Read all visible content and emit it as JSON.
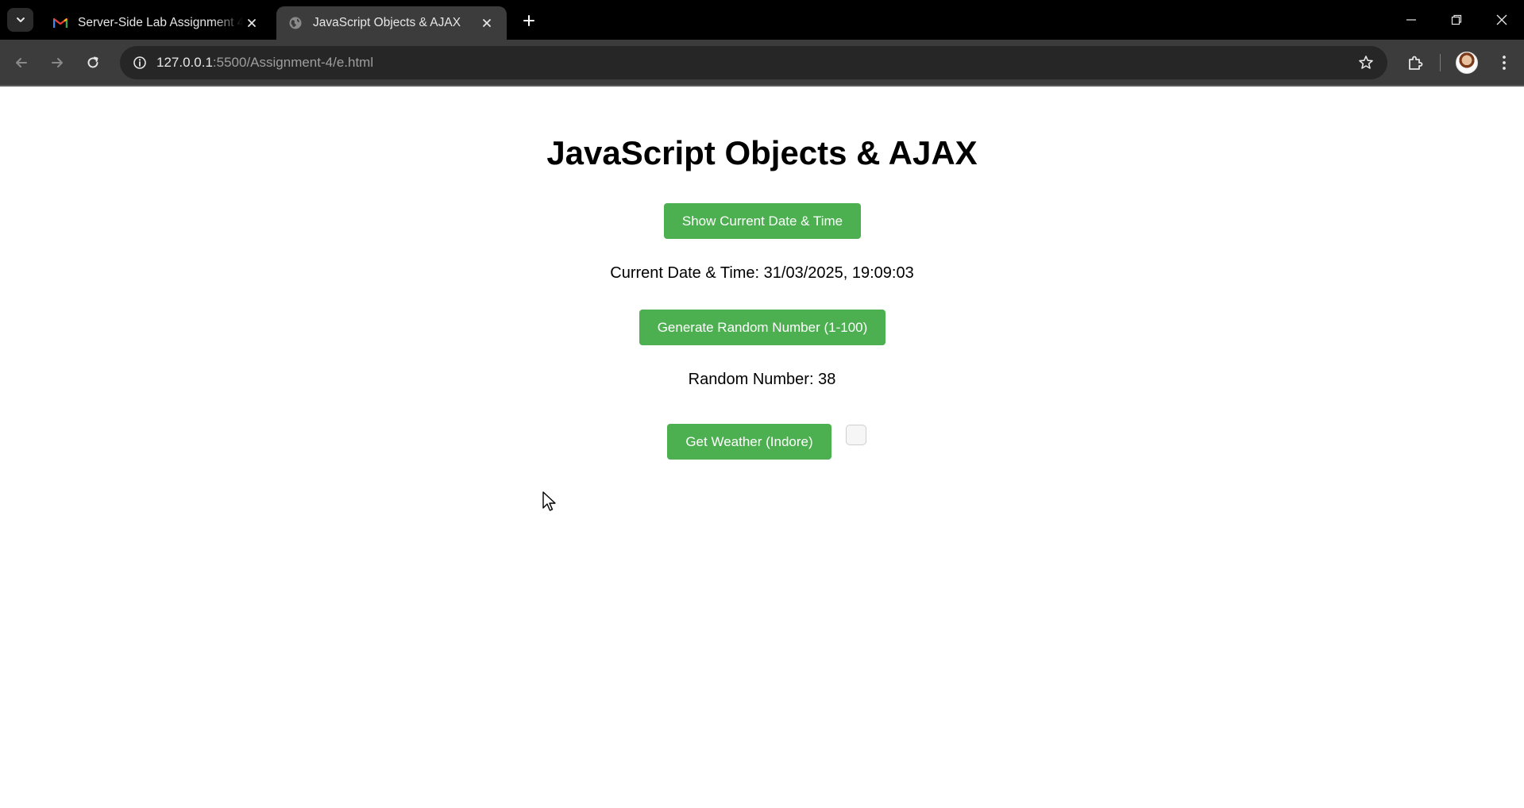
{
  "browser": {
    "tabs": [
      {
        "title": "Server-Side Lab Assignment 4 -",
        "favicon": "gmail-icon",
        "active": false
      },
      {
        "title": "JavaScript Objects & AJAX",
        "favicon": "globe-icon",
        "active": true
      }
    ],
    "address": {
      "host": "127.0.0.1",
      "rest": ":5500/Assignment-4/e.html"
    }
  },
  "page": {
    "heading": "JavaScript Objects & AJAX",
    "date_button_label": "Show Current Date & Time",
    "date_output": "Current Date & Time: 31/03/2025, 19:09:03",
    "random_button_label": "Generate Random Number (1-100)",
    "random_output": "Random Number: 38",
    "weather_button_label": "Get Weather (Indore)",
    "accent_color": "#4caf50"
  }
}
